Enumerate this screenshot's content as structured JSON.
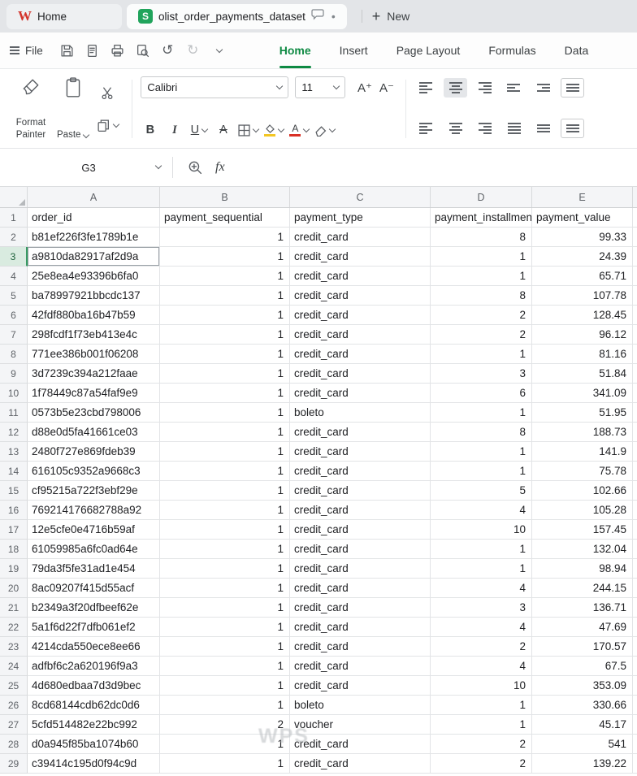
{
  "tabbar": {
    "home_tab": "Home",
    "doc_tab": "olist_order_payments_dataset",
    "new_label": "New"
  },
  "menu": {
    "file_label": "File",
    "ribbon_tabs": [
      "Home",
      "Insert",
      "Page Layout",
      "Formulas",
      "Data"
    ],
    "active_tab": "Home"
  },
  "ribbon": {
    "format_painter_label": "Format Painter",
    "paste_label": "Paste",
    "font_name": "Calibri",
    "font_size": "11"
  },
  "formula_bar": {
    "cell_ref": "G3",
    "fx_label": "fx",
    "formula_value": ""
  },
  "icons": {
    "w_logo": "W",
    "sheet_logo": "S",
    "plus": "+",
    "dot": "•",
    "undo": "↺",
    "redo": "↻",
    "bold": "B",
    "italic": "I",
    "underline": "U",
    "strike": "A",
    "font_color": "A",
    "fill_color_hex": "#f3c623",
    "font_color_hex": "#d93025",
    "grow_font": "A⁺",
    "shrink_font": "A⁻"
  },
  "watermark": "WPS",
  "sheet": {
    "columns": [
      "A",
      "B",
      "C",
      "D",
      "E"
    ],
    "selected_row": 3,
    "boxed_cell": {
      "row": 3,
      "col": 0
    },
    "rows": [
      [
        "order_id",
        "payment_sequential",
        "payment_type",
        "payment_installments",
        "payment_value"
      ],
      [
        "b81ef226f3fe1789b1e",
        1,
        "credit_card",
        8,
        99.33
      ],
      [
        "a9810da82917af2d9a",
        1,
        "credit_card",
        1,
        24.39
      ],
      [
        "25e8ea4e93396b6fa0",
        1,
        "credit_card",
        1,
        65.71
      ],
      [
        "ba78997921bbcdc137",
        1,
        "credit_card",
        8,
        107.78
      ],
      [
        "42fdf880ba16b47b59",
        1,
        "credit_card",
        2,
        128.45
      ],
      [
        "298fcdf1f73eb413e4c",
        1,
        "credit_card",
        2,
        96.12
      ],
      [
        "771ee386b001f06208",
        1,
        "credit_card",
        1,
        81.16
      ],
      [
        "3d7239c394a212faae",
        1,
        "credit_card",
        3,
        51.84
      ],
      [
        "1f78449c87a54faf9e9",
        1,
        "credit_card",
        6,
        341.09
      ],
      [
        "0573b5e23cbd798006",
        1,
        "boleto",
        1,
        51.95
      ],
      [
        "d88e0d5fa41661ce03",
        1,
        "credit_card",
        8,
        188.73
      ],
      [
        "2480f727e869fdeb39",
        1,
        "credit_card",
        1,
        141.9
      ],
      [
        "616105c9352a9668c3",
        1,
        "credit_card",
        1,
        75.78
      ],
      [
        "cf95215a722f3ebf29e",
        1,
        "credit_card",
        5,
        102.66
      ],
      [
        "769214176682788a92",
        1,
        "credit_card",
        4,
        105.28
      ],
      [
        "12e5cfe0e4716b59af",
        1,
        "credit_card",
        10,
        157.45
      ],
      [
        "61059985a6fc0ad64e",
        1,
        "credit_card",
        1,
        132.04
      ],
      [
        "79da3f5fe31ad1e454",
        1,
        "credit_card",
        1,
        98.94
      ],
      [
        "8ac09207f415d55acf",
        1,
        "credit_card",
        4,
        244.15
      ],
      [
        "b2349a3f20dfbeef62e",
        1,
        "credit_card",
        3,
        136.71
      ],
      [
        "5a1f6d22f7dfb061ef2",
        1,
        "credit_card",
        4,
        47.69
      ],
      [
        "4214cda550ece8ee66",
        1,
        "credit_card",
        2,
        170.57
      ],
      [
        "adfbf6c2a620196f9a3",
        1,
        "credit_card",
        4,
        67.5
      ],
      [
        "4d680edbaa7d3d9bec",
        1,
        "credit_card",
        10,
        353.09
      ],
      [
        "8cd68144cdb62dc0d6",
        1,
        "boleto",
        1,
        330.66
      ],
      [
        "5cfd514482e22bc992",
        2,
        "voucher",
        1,
        45.17
      ],
      [
        "d0a945f85ba1074b60",
        1,
        "credit_card",
        2,
        541
      ],
      [
        "c39414c195d0f94c9d",
        1,
        "credit_card",
        2,
        139.22
      ]
    ]
  }
}
